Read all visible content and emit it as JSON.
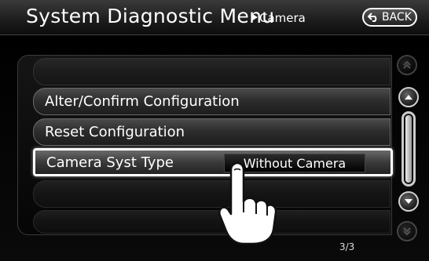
{
  "header": {
    "title": "System Diagnostic Menu",
    "breadcrumb": "Camera",
    "back_label": "BACK"
  },
  "menu": {
    "items": [
      {
        "label": "Alter/Confirm Configuration"
      },
      {
        "label": "Reset Configuration"
      },
      {
        "label": "Camera Syst Type",
        "value": "Without Camera"
      }
    ]
  },
  "pagination": {
    "indicator": "3/3"
  },
  "icons": [
    "back-arrow-icon",
    "page-up-icon",
    "scroll-up-icon",
    "scroll-down-icon",
    "page-down-icon",
    "pointing-hand-icon"
  ]
}
